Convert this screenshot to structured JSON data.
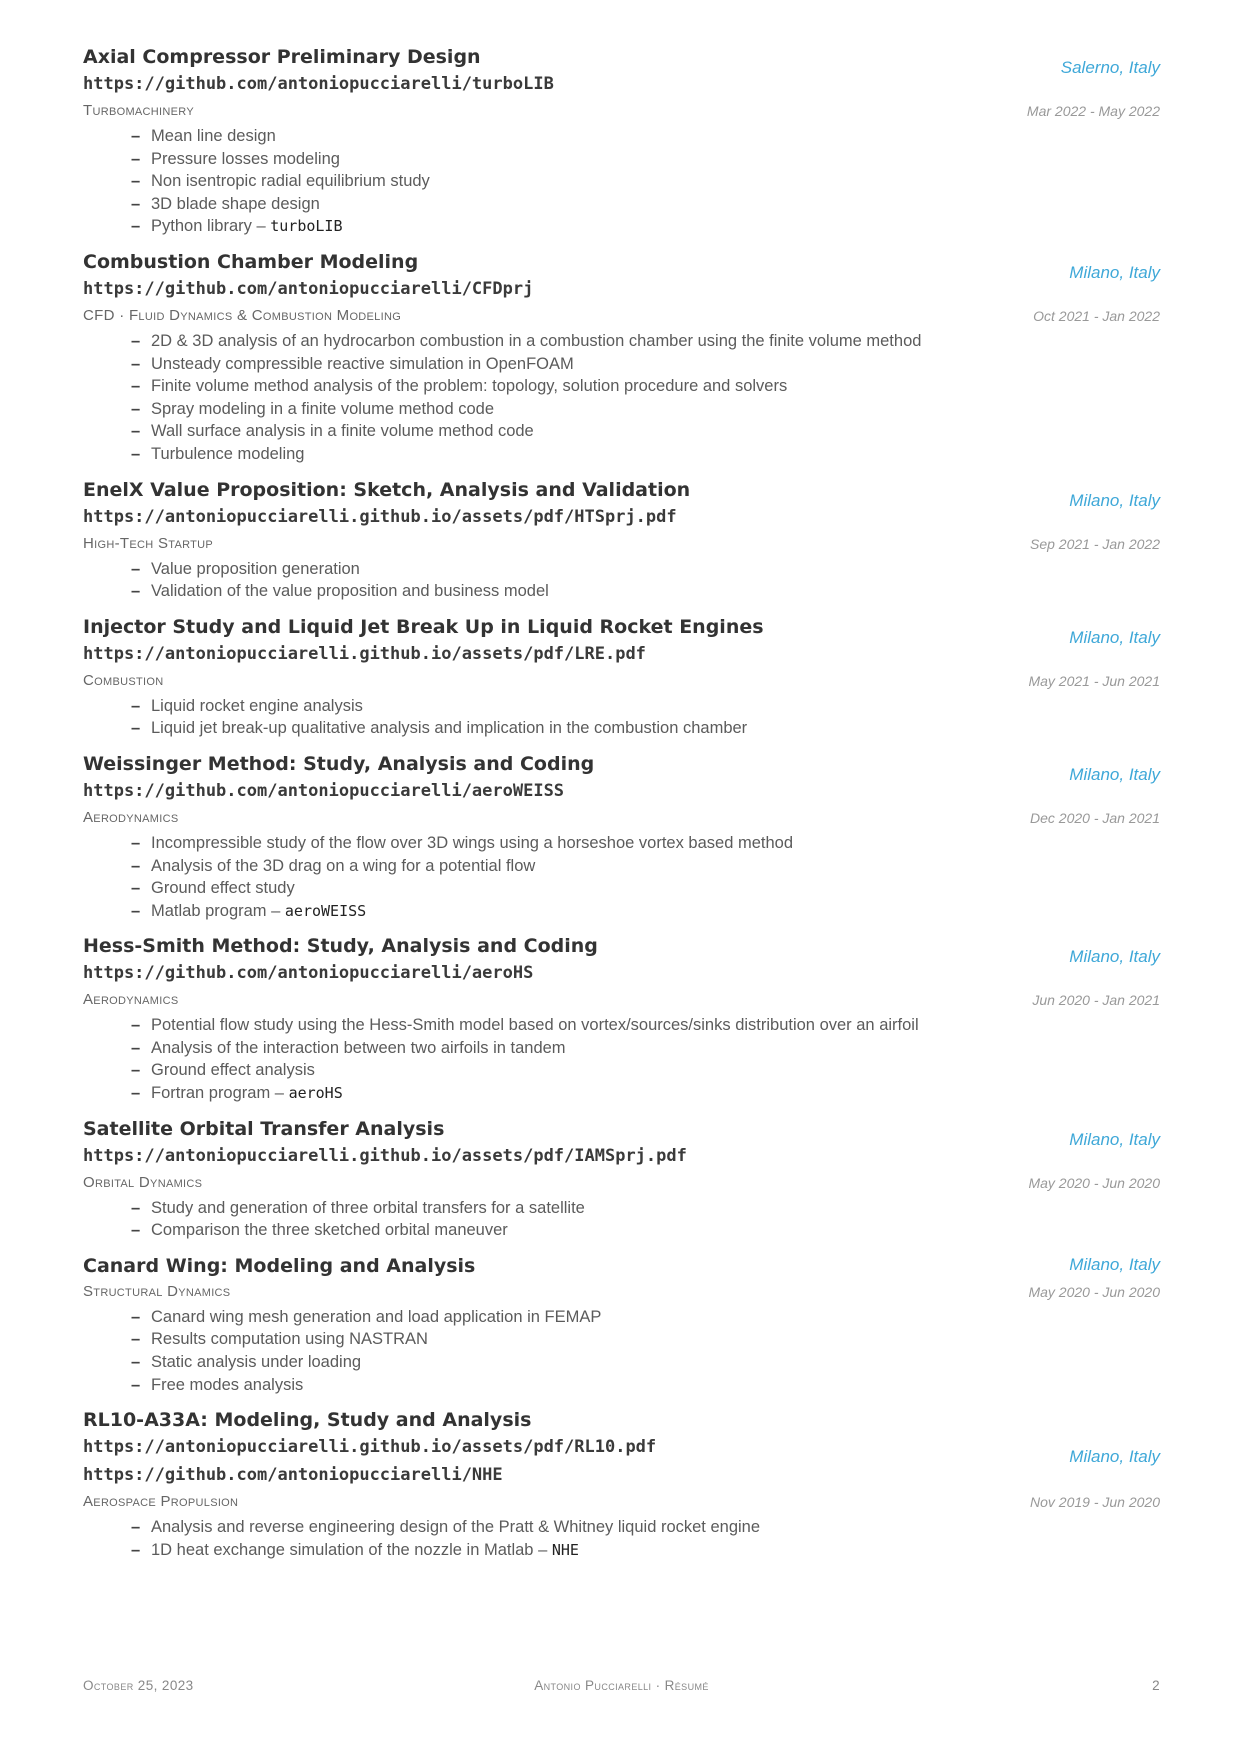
{
  "entries": [
    {
      "title": "Axial Compressor Preliminary Design",
      "urls": [
        "https://github.com/antoniopucciarelli/turboLIB"
      ],
      "location": "Salerno, Italy",
      "category": "Turbomachinery",
      "date": "Mar 2022 - May 2022",
      "items": [
        {
          "text": "Mean line design",
          "code": ""
        },
        {
          "text": "Pressure losses modeling",
          "code": ""
        },
        {
          "text": "Non isentropic radial equilibrium study",
          "code": ""
        },
        {
          "text": "3D blade shape design",
          "code": ""
        },
        {
          "text": "Python library – ",
          "code": "turboLIB"
        }
      ]
    },
    {
      "title": "Combustion Chamber Modeling",
      "urls": [
        "https://github.com/antoniopucciarelli/CFDprj"
      ],
      "location": "Milano, Italy",
      "category": "CFD · Fluid Dynamics & Combustion Modeling",
      "date": "Oct 2021 - Jan 2022",
      "items": [
        {
          "text": "2D & 3D analysis of an hydrocarbon combustion in a combustion chamber using the finite volume method",
          "code": ""
        },
        {
          "text": "Unsteady compressible reactive simulation in OpenFOAM",
          "code": ""
        },
        {
          "text": "Finite volume method analysis of the problem: topology, solution procedure and solvers",
          "code": ""
        },
        {
          "text": "Spray modeling in a finite volume method code",
          "code": ""
        },
        {
          "text": "Wall surface analysis in a finite volume method code",
          "code": ""
        },
        {
          "text": "Turbulence modeling",
          "code": ""
        }
      ]
    },
    {
      "title": "EnelX Value Proposition: Sketch, Analysis and Validation",
      "urls": [
        "https://antoniopucciarelli.github.io/assets/pdf/HTSprj.pdf"
      ],
      "location": "Milano, Italy",
      "category": "High-Tech Startup",
      "date": "Sep 2021 - Jan 2022",
      "items": [
        {
          "text": "Value proposition generation",
          "code": ""
        },
        {
          "text": "Validation of the value proposition and business model",
          "code": ""
        }
      ]
    },
    {
      "title": "Injector Study and Liquid Jet Break Up in Liquid Rocket Engines",
      "urls": [
        "https://antoniopucciarelli.github.io/assets/pdf/LRE.pdf"
      ],
      "location": "Milano, Italy",
      "category": "Combustion",
      "date": "May 2021 - Jun 2021",
      "items": [
        {
          "text": "Liquid rocket engine analysis",
          "code": ""
        },
        {
          "text": "Liquid jet break-up qualitative analysis and implication in the combustion chamber",
          "code": ""
        }
      ]
    },
    {
      "title": "Weissinger Method: Study, Analysis and Coding",
      "urls": [
        "https://github.com/antoniopucciarelli/aeroWEISS"
      ],
      "location": "Milano, Italy",
      "category": "Aerodynamics",
      "date": "Dec 2020 - Jan 2021",
      "items": [
        {
          "text": "Incompressible study of the flow over 3D wings using a horseshoe vortex based method",
          "code": ""
        },
        {
          "text": "Analysis of the 3D drag on a wing for a potential flow",
          "code": ""
        },
        {
          "text": "Ground effect study",
          "code": ""
        },
        {
          "text": "Matlab program – ",
          "code": "aeroWEISS"
        }
      ]
    },
    {
      "title": "Hess-Smith Method: Study, Analysis and Coding",
      "urls": [
        "https://github.com/antoniopucciarelli/aeroHS"
      ],
      "location": "Milano, Italy",
      "category": "Aerodynamics",
      "date": "Jun 2020 - Jan 2021",
      "items": [
        {
          "text": "Potential flow study using the Hess-Smith model based on vortex/sources/sinks distribution over an airfoil",
          "code": ""
        },
        {
          "text": "Analysis of the interaction between two airfoils in tandem",
          "code": ""
        },
        {
          "text": "Ground effect analysis",
          "code": ""
        },
        {
          "text": "Fortran program – ",
          "code": "aeroHS"
        }
      ]
    },
    {
      "title": "Satellite Orbital Transfer Analysis",
      "urls": [
        "https://antoniopucciarelli.github.io/assets/pdf/IAMSprj.pdf"
      ],
      "location": "Milano, Italy",
      "category": "Orbital Dynamics",
      "date": "May 2020 - Jun 2020",
      "items": [
        {
          "text": "Study and generation of three orbital transfers for a satellite",
          "code": ""
        },
        {
          "text": "Comparison the three sketched orbital maneuver",
          "code": ""
        }
      ]
    },
    {
      "title": "Canard Wing: Modeling and Analysis",
      "urls": [],
      "location": "Milano, Italy",
      "category": "Structural Dynamics",
      "date": "May 2020 - Jun 2020",
      "items": [
        {
          "text": "Canard wing mesh generation and load application in FEMAP",
          "code": ""
        },
        {
          "text": "Results computation using NASTRAN",
          "code": ""
        },
        {
          "text": "Static analysis under loading",
          "code": ""
        },
        {
          "text": "Free modes analysis",
          "code": ""
        }
      ]
    },
    {
      "title": "RL10-A33A: Modeling, Study and Analysis",
      "urls": [
        "https://antoniopucciarelli.github.io/assets/pdf/RL10.pdf",
        "https://github.com/antoniopucciarelli/NHE"
      ],
      "location": "Milano, Italy",
      "category": "Aerospace Propulsion",
      "date": "Nov 2019 - Jun 2020",
      "items": [
        {
          "text": "Analysis and reverse engineering design of the Pratt & Whitney liquid rocket engine",
          "code": ""
        },
        {
          "text": "1D heat exchange simulation of the nozzle in Matlab – ",
          "code": "NHE"
        }
      ]
    }
  ],
  "footer": {
    "date": "October 25, 2023",
    "center": "Antonio Pucciarelli · Résumé",
    "page": "2"
  }
}
